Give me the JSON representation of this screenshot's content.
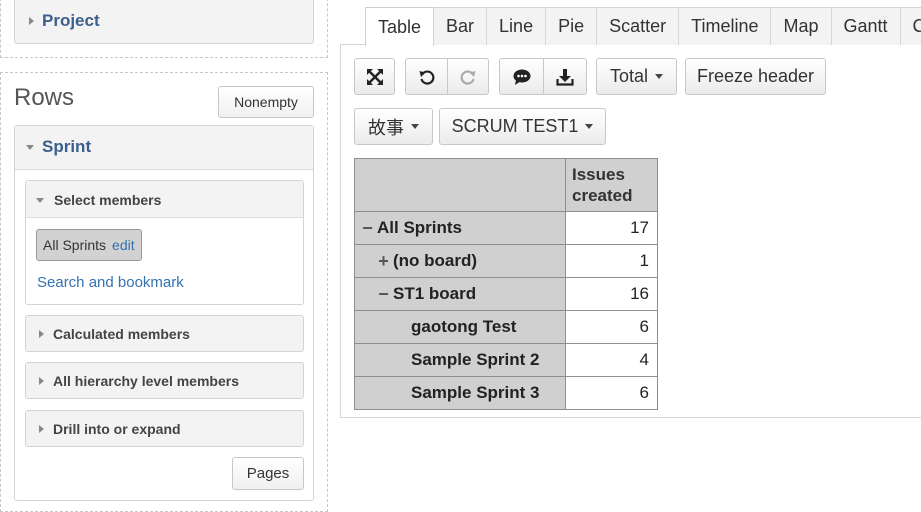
{
  "left": {
    "project": {
      "title": "Project"
    },
    "rows": {
      "title": "Rows",
      "nonempty_label": "Nonempty",
      "sprint": {
        "title": "Sprint",
        "select_members": {
          "title": "Select members",
          "chip_label": "All Sprints",
          "chip_edit": "edit",
          "search_link": "Search and bookmark"
        },
        "sections": [
          {
            "title": "Calculated members"
          },
          {
            "title": "All hierarchy level members"
          },
          {
            "title": "Drill into or expand"
          }
        ],
        "pages_label": "Pages"
      }
    }
  },
  "tabs": [
    "Table",
    "Bar",
    "Line",
    "Pie",
    "Scatter",
    "Timeline",
    "Map",
    "Gantt",
    "C"
  ],
  "active_tab": "Table",
  "toolbar": {
    "icons": [
      "fullscreen-icon",
      "undo-icon",
      "redo-icon",
      "comment-icon",
      "download-icon"
    ],
    "total_label": "Total",
    "freeze_label": "Freeze header",
    "filter1_label": "故事",
    "filter2_label": "SCRUM TEST1"
  },
  "table": {
    "column_header": "Issues created",
    "rows": [
      {
        "label": "All Sprints",
        "value": "17",
        "level": 0,
        "toggle": "−"
      },
      {
        "label": "(no board)",
        "value": "1",
        "level": 1,
        "toggle": "+"
      },
      {
        "label": "ST1 board",
        "value": "16",
        "level": 1,
        "toggle": "−"
      },
      {
        "label": "gaotong Test",
        "value": "6",
        "level": 2,
        "toggle": ""
      },
      {
        "label": "Sample Sprint 2",
        "value": "4",
        "level": 2,
        "toggle": ""
      },
      {
        "label": "Sample Sprint 3",
        "value": "6",
        "level": 2,
        "toggle": ""
      }
    ]
  },
  "colors": {
    "accent_link": "#3572b0",
    "header_title": "#3b5e8c",
    "table_header_bg": "#d0d0d0"
  }
}
